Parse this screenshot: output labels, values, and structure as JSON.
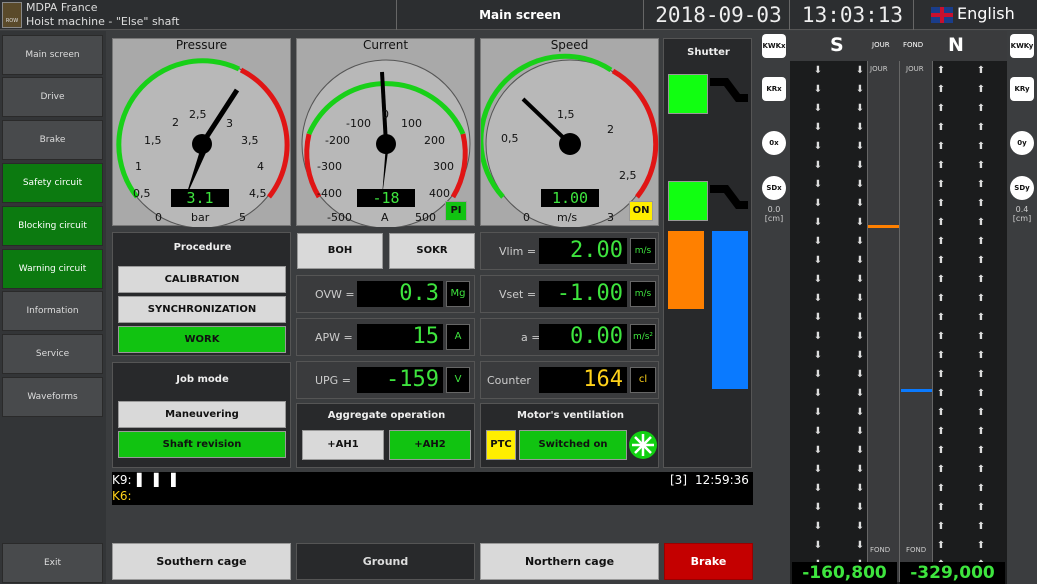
{
  "header": {
    "logo_text": "ROW",
    "company": "MDPA France",
    "machine": "Hoist machine - \"Else\" shaft",
    "screen_title": "Main screen",
    "date": "2018-09-03",
    "time": "13:03:13",
    "language": "English"
  },
  "sidebar": {
    "items": [
      {
        "label": "Main screen"
      },
      {
        "label": "Drive"
      },
      {
        "label": "Brake"
      },
      {
        "label": "Safety circuit"
      },
      {
        "label": "Blocking circuit"
      },
      {
        "label": "Warning circuit"
      },
      {
        "label": "Information"
      },
      {
        "label": "Service"
      },
      {
        "label": "Waveforms"
      }
    ],
    "exit_label": "Exit"
  },
  "gauges": {
    "pressure": {
      "title": "Pressure",
      "unit": "bar",
      "value": "3.1",
      "ticks": [
        "0",
        "0,5",
        "1",
        "1,5",
        "2",
        "2,5",
        "3",
        "3,5",
        "4",
        "4,5",
        "5"
      ]
    },
    "current": {
      "title": "Current",
      "unit": "A",
      "value": "-18",
      "ticks": [
        "-500",
        "-400",
        "-300",
        "-200",
        "-100",
        "0",
        "100",
        "200",
        "300",
        "400",
        "500"
      ],
      "badge": "PI"
    },
    "speed": {
      "title": "Speed",
      "unit": "m/s",
      "value": "1.00",
      "ticks": [
        "0",
        "0,5",
        "1,5",
        "2",
        "2,5",
        "3"
      ],
      "badge": "ON"
    }
  },
  "shutter": {
    "title": "Shutter"
  },
  "procedure": {
    "title": "Procedure",
    "buttons": [
      {
        "label": "CALIBRATION"
      },
      {
        "label": "SYNCHRONIZATION"
      },
      {
        "label": "WORK"
      }
    ]
  },
  "job_mode": {
    "title": "Job mode",
    "buttons": [
      {
        "label": "Maneuvering"
      },
      {
        "label": "Shaft revision"
      }
    ]
  },
  "middle": {
    "boh_label": "BOH",
    "sokr_label": "SOKR",
    "ovw": {
      "label": "OVW =",
      "value": "0.3",
      "unit": "Mg"
    },
    "apw": {
      "label": "APW =",
      "value": "15",
      "unit": "A"
    },
    "upg": {
      "label": "UPG =",
      "value": "-159",
      "unit": "V"
    },
    "aggregate": {
      "title": "Aggregate operation",
      "btn1": "+AH1",
      "btn2": "+AH2"
    }
  },
  "right": {
    "vlim": {
      "label": "Vlim =",
      "value": "2.00",
      "unit": "m/s"
    },
    "vset": {
      "label": "Vset =",
      "value": "-1.00",
      "unit": "m/s"
    },
    "a": {
      "label": "a =",
      "value": "0.00",
      "unit": "m/s²"
    },
    "counter": {
      "label": "Counter",
      "value": "164",
      "unit": "cl"
    },
    "ventilation": {
      "title": "Motor's ventilation",
      "ptc": "PTC",
      "status": "Switched on"
    }
  },
  "messages": {
    "k9_label": "K9:",
    "k9_marks": "▌ ▌ ▌",
    "k6_label": "K6:",
    "entry_index": "[3]",
    "entry_time": "12:59:36"
  },
  "bottom": {
    "southern": "Southern cage",
    "ground": "Ground",
    "northern": "Northern cage",
    "brake": "Brake"
  },
  "shaft": {
    "s_label": "S",
    "n_label": "N",
    "jour": "JOUR",
    "fond": "FOND",
    "left_buttons": [
      "KWKx",
      "KRx",
      "0x",
      "SDx"
    ],
    "right_buttons": [
      "KWKy",
      "KRy",
      "0y",
      "SDy"
    ],
    "sdx_value": "0.0",
    "sdy_value": "0.4",
    "unit": "[cm]",
    "s_position": "-160,800",
    "n_position": "-329,000",
    "colors": {
      "orange": "#ff8000",
      "blue": "#0a7aff"
    }
  }
}
